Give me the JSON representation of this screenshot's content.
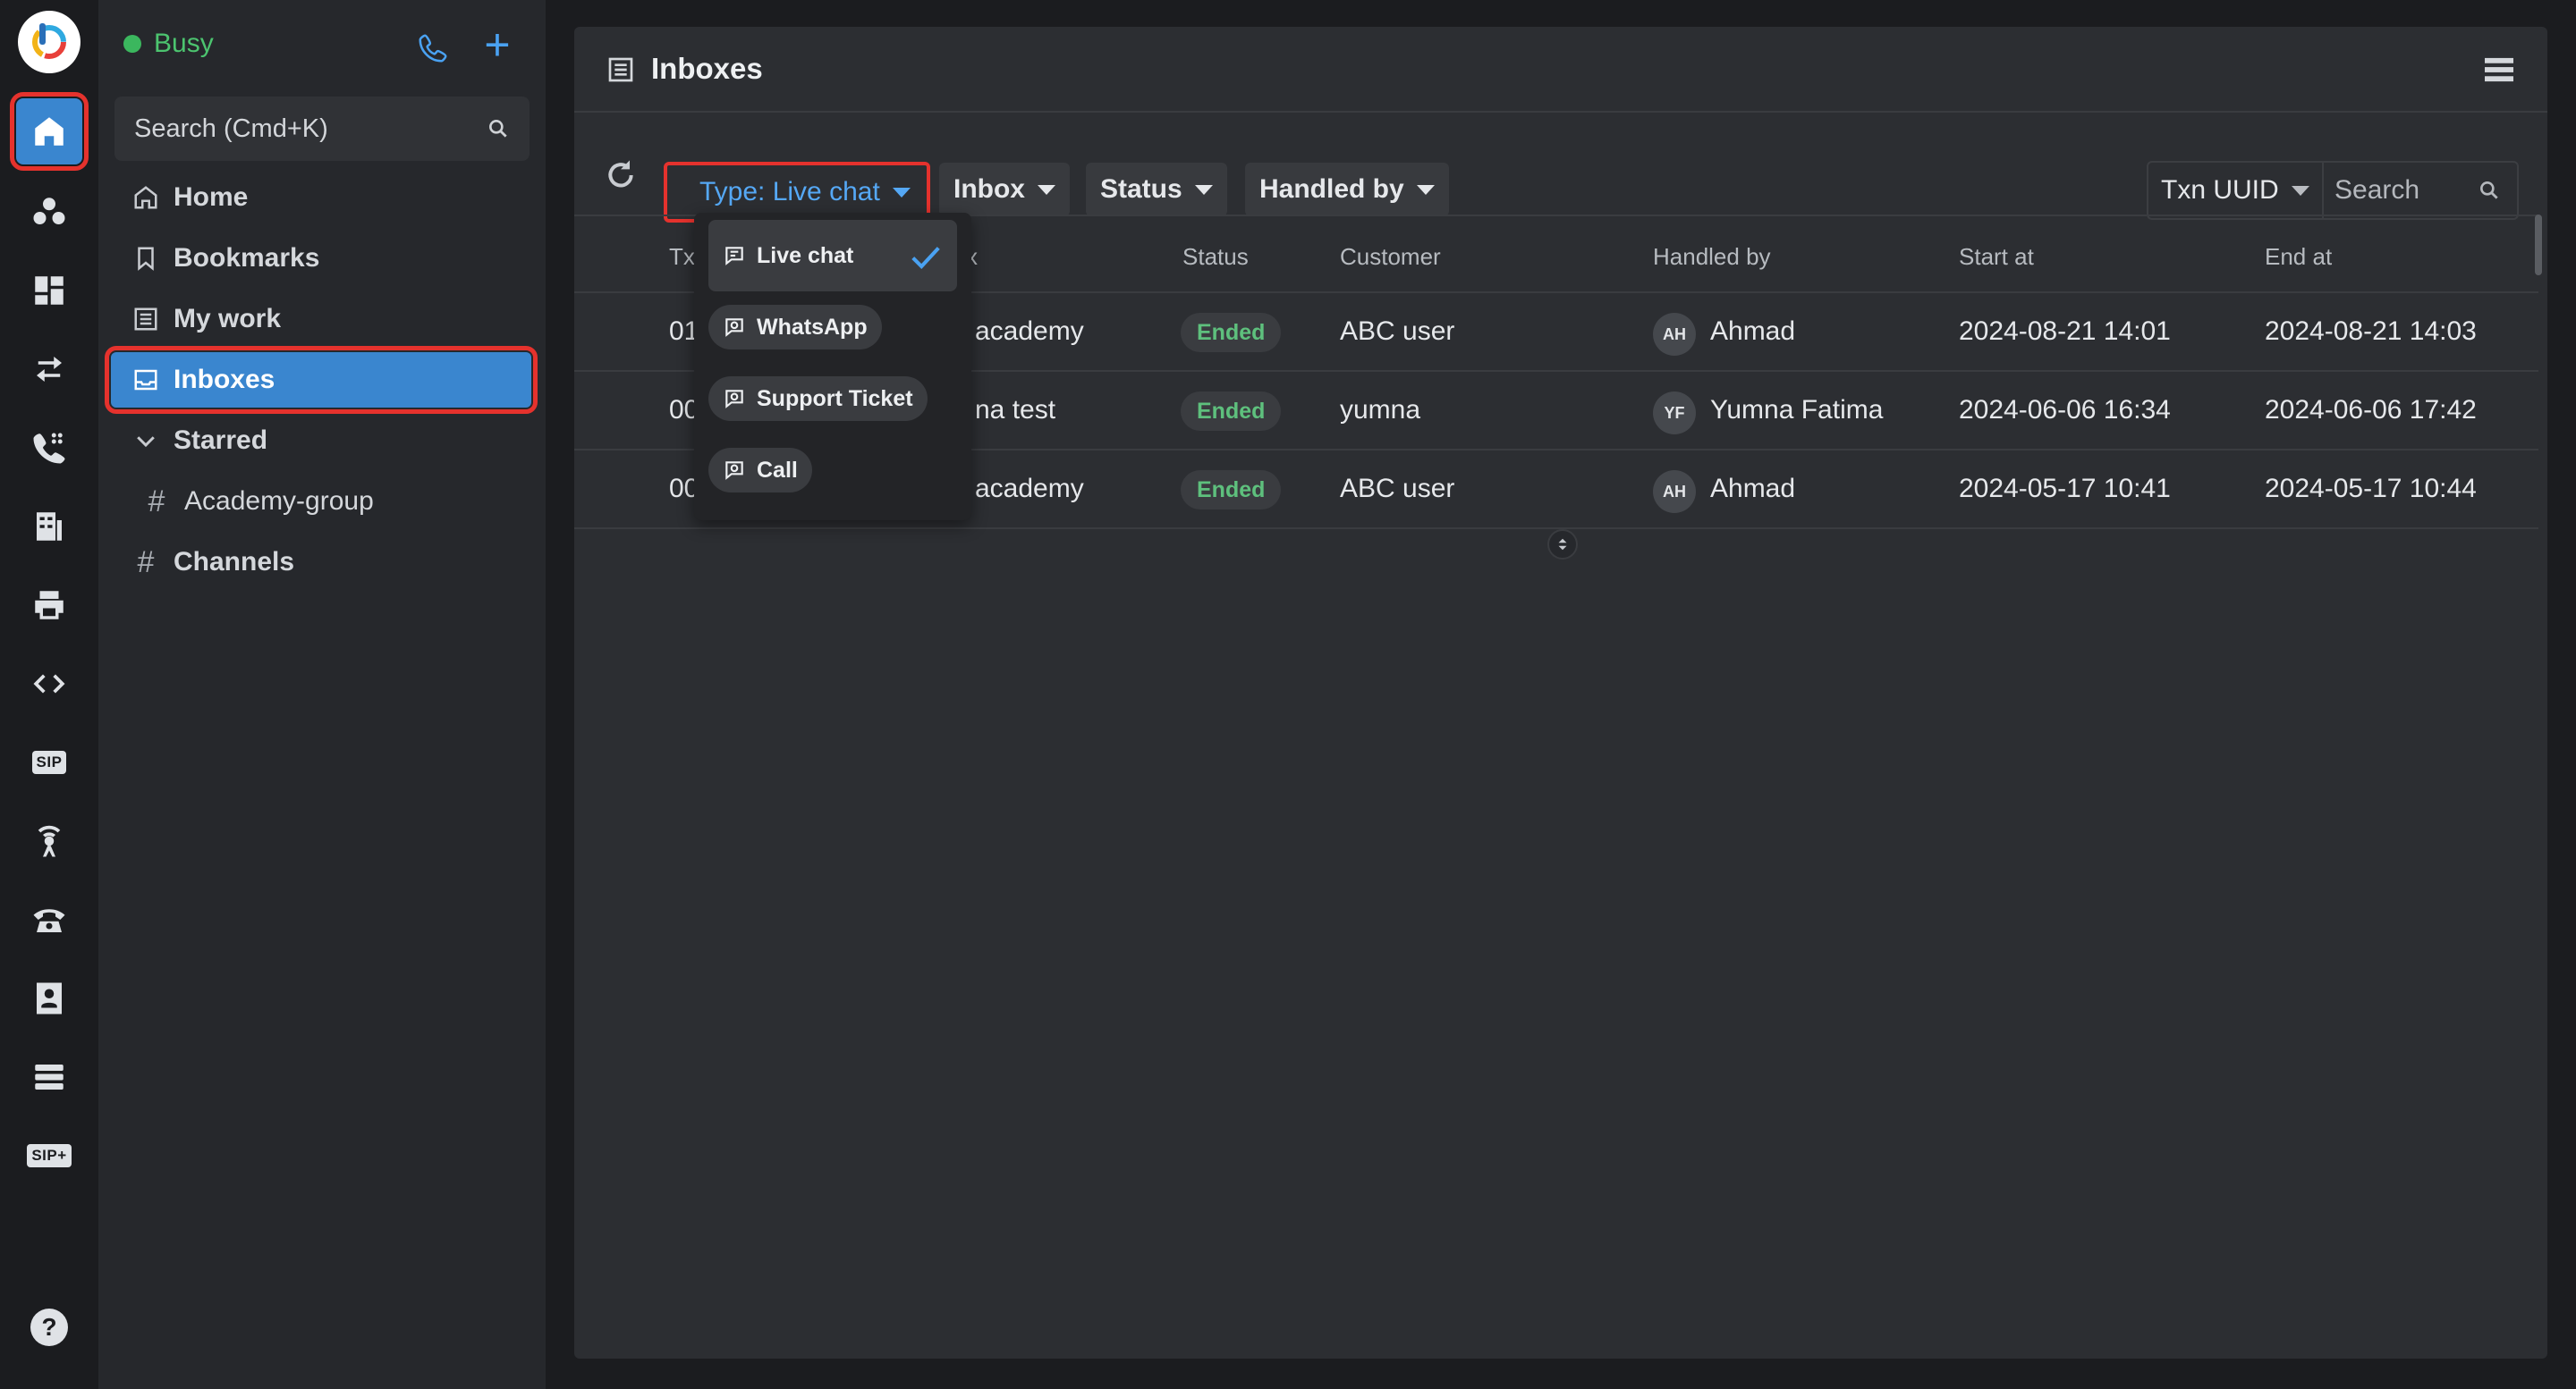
{
  "sidebar": {
    "status": "Busy",
    "search_placeholder": "Search (Cmd+K)",
    "nav": {
      "home": "Home",
      "bookmarks": "Bookmarks",
      "my_work": "My work",
      "inboxes": "Inboxes",
      "starred": "Starred",
      "academy_group": "Academy-group",
      "channels": "Channels"
    }
  },
  "main": {
    "title": "Inboxes",
    "filters": {
      "type": "Type: Live chat",
      "inbox": "Inbox",
      "status": "Status",
      "handled_by": "Handled by"
    },
    "search": {
      "field": "Txn UUID",
      "placeholder": "Search"
    },
    "columns": {
      "txn": "Tx",
      "inbox": "x",
      "status": "Status",
      "customer": "Customer",
      "handled_by": "Handled by",
      "start_at": "Start at",
      "end_at": "End at"
    },
    "rows": [
      {
        "txn": "01",
        "inbox": "academy",
        "status": "Ended",
        "customer": "ABC user",
        "agent_initials": "AH",
        "agent": "Ahmad",
        "start": "2024-08-21 14:01",
        "end": "2024-08-21 14:03"
      },
      {
        "txn": "00",
        "inbox": "na test",
        "status": "Ended",
        "customer": "yumna",
        "agent_initials": "YF",
        "agent": "Yumna Fatima",
        "start": "2024-06-06 16:34",
        "end": "2024-06-06 17:42"
      },
      {
        "txn": "00",
        "inbox": "academy",
        "status": "Ended",
        "customer": "ABC user",
        "agent_initials": "AH",
        "agent": "Ahmad",
        "start": "2024-05-17 10:41",
        "end": "2024-05-17 10:44"
      }
    ]
  },
  "type_dropdown": {
    "options": [
      "Live chat",
      "WhatsApp",
      "Support Ticket",
      "Call"
    ],
    "selected": "Live chat"
  },
  "colors": {
    "accent": "#3a86cf",
    "highlight_border": "#e5322d",
    "status_busy": "#3bb75e",
    "status_ended": "#5ec07d"
  }
}
